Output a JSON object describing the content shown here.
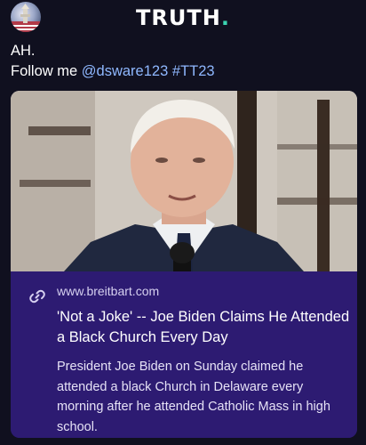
{
  "header": {
    "logo_text": "TRUTH",
    "logo_dot": ".",
    "logo_dot_color": "#3bd4b1"
  },
  "post": {
    "line1": "AH.",
    "line2_prefix": "Follow me ",
    "handle": "@dsware123",
    "hashtag": "#TT23",
    "link_color": "#8fb8ff"
  },
  "card": {
    "domain": "www.breitbart.com",
    "headline": "'Not a Joke' -- Joe Biden Claims He Attended a Black Church Every Day",
    "description": "President Joe Biden on Sunday claimed he attended a black Church in Delaware every morning after he attended Catholic Mass in high school.",
    "background_color": "#2d1b72"
  },
  "icons": {
    "avatar": "profile-avatar",
    "link": "link-icon",
    "microphone": "microphone"
  }
}
